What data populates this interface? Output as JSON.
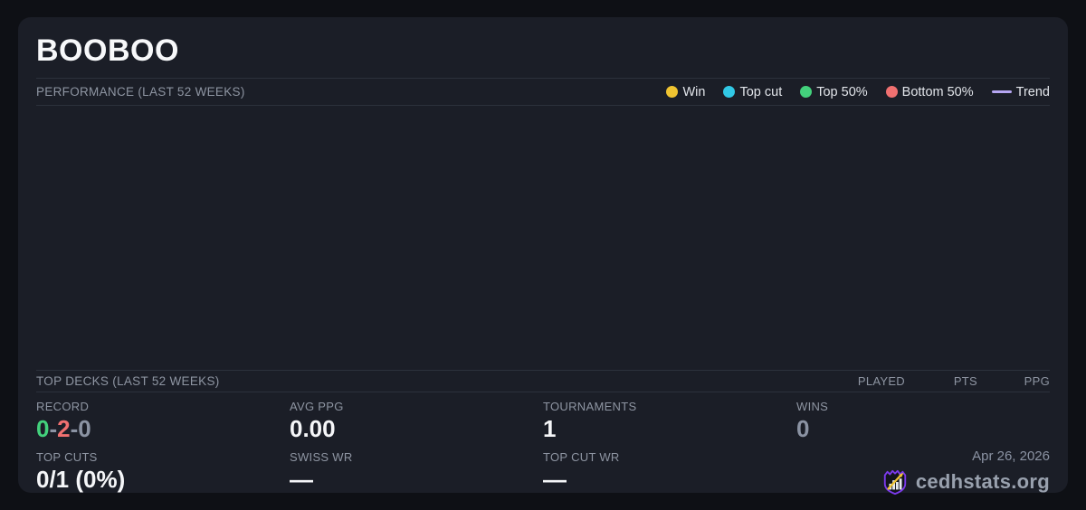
{
  "title": "BOOBOO",
  "performance": {
    "heading": "PERFORMANCE (LAST 52 WEEKS)",
    "legend": [
      {
        "label": "Win",
        "marker": "dot",
        "color": "#f0c431"
      },
      {
        "label": "Top cut",
        "marker": "dot",
        "color": "#31c8e5"
      },
      {
        "label": "Top 50%",
        "marker": "dot",
        "color": "#43d17c"
      },
      {
        "label": "Bottom 50%",
        "marker": "dot",
        "color": "#f07070"
      },
      {
        "label": "Trend",
        "marker": "line",
        "color": "#b6a6f2"
      }
    ],
    "chart_points": []
  },
  "top_decks": {
    "heading": "TOP DECKS (LAST 52 WEEKS)",
    "columns": [
      "PLAYED",
      "PTS",
      "PPG"
    ],
    "rows": []
  },
  "stats": {
    "record": {
      "label": "RECORD",
      "wins": "0",
      "losses": "2",
      "draws": "0",
      "separator": "-",
      "wins_color": "#43d17c",
      "losses_color": "#f07070",
      "draws_color": "#8b93a3"
    },
    "avg_ppg": {
      "label": "AVG PPG",
      "value": "0.00"
    },
    "tournaments": {
      "label": "TOURNAMENTS",
      "value": "1"
    },
    "wins": {
      "label": "WINS",
      "value": "0"
    },
    "top_cuts": {
      "label": "TOP CUTS",
      "value": "0/1 (0%)"
    },
    "swiss_wr": {
      "label": "SWISS WR",
      "value": "—"
    },
    "top_cut_wr": {
      "label": "TOP CUT WR",
      "value": "—"
    }
  },
  "footer": {
    "date": "Apr 26, 2026",
    "brand": "cedhstats.org",
    "logo_purple": "#7c3aed",
    "logo_gold": "#f0c431"
  }
}
